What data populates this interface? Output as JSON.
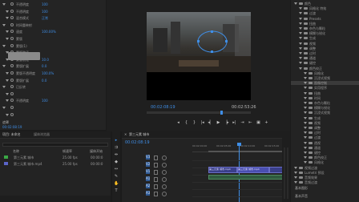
{
  "effect_controls": {
    "rows": [
      {
        "label": "不透明度",
        "value": "100"
      },
      {
        "label": "不透明度",
        "value": "100"
      },
      {
        "label": "混合模式",
        "value": "正常"
      },
      {
        "label": "时间重映射",
        "value": ""
      },
      {
        "label": "速度",
        "value": "100.00%"
      },
      {
        "label": "蒙版",
        "value": ""
      },
      {
        "label": "蒙版(1)",
        "value": ""
      },
      {
        "label": "蒙版路径",
        "value": ""
      },
      {
        "label": "蒙版羽化",
        "value": "10.0"
      },
      {
        "label": "蒙版扩展",
        "value": "0.0"
      },
      {
        "label": "蒙版不透明度",
        "value": "100.0%"
      },
      {
        "label": "蒙版扩展",
        "value": "0.0"
      },
      {
        "label": "已反转",
        "value": ""
      },
      {
        "label": "",
        "value": ""
      },
      {
        "label": "不透明度",
        "value": "100"
      },
      {
        "label": "",
        "value": ""
      },
      {
        "label": "",
        "value": ""
      }
    ],
    "bottom_label": "遮罩",
    "timecode": "00:02:08:19"
  },
  "program": {
    "timecode_left": "00:02:08:19",
    "timecode_right": "00:02:53:26",
    "controls": [
      "◂",
      "{",
      "}",
      "|◂",
      "◂▏",
      "▶",
      "▕▸",
      "▸|",
      "⇥",
      "⇤",
      "▣",
      "+"
    ]
  },
  "effects_browser": {
    "items": [
      {
        "label": "颜色"
      },
      {
        "label": "风格化 特效"
      },
      {
        "label": "过渡"
      },
      {
        "label": "Presets"
      },
      {
        "label": "扭曲"
      },
      {
        "label": "杂色与颗粒"
      },
      {
        "label": "模糊与锐化"
      },
      {
        "label": "生成"
      },
      {
        "label": "视频"
      },
      {
        "label": "调整"
      },
      {
        "label": "过时"
      },
      {
        "label": "通道"
      },
      {
        "label": "键控"
      },
      {
        "label": "颜色校正"
      },
      {
        "label": "风格化"
      },
      {
        "label": "沉浸式视频"
      },
      {
        "label": "图像控制"
      },
      {
        "label": "实用程序"
      },
      {
        "label": "扭曲"
      },
      {
        "label": "时间"
      },
      {
        "label": "杂色与颗粒"
      },
      {
        "label": "模糊与锐化"
      },
      {
        "label": "沉浸式视频"
      },
      {
        "label": "生成"
      },
      {
        "label": "视频"
      },
      {
        "label": "调整"
      },
      {
        "label": "过时"
      },
      {
        "label": "过渡"
      },
      {
        "label": "透视"
      },
      {
        "label": "通道"
      },
      {
        "label": "键控"
      },
      {
        "label": "颜色校正"
      },
      {
        "label": "风格化"
      },
      {
        "label": "视频过渡"
      },
      {
        "label": "Lumetri 预设"
      },
      {
        "label": "音频效果"
      },
      {
        "label": "音频过渡"
      }
    ],
    "footer": [
      "基本图形",
      "基本声音"
    ]
  },
  "project": {
    "tabs": [
      "项目: 未命名",
      "媒体浏览器"
    ],
    "search_placeholder": "",
    "columns": [
      "名称",
      "帧速率",
      "媒体开始"
    ],
    "rows": [
      {
        "name": "第三元素 城市",
        "rate": "25.00 fps",
        "start": "00:00:0"
      },
      {
        "name": "第三元素 城市.mp4",
        "rate": "25.00 fps",
        "start": "00:00:0"
      }
    ]
  },
  "timeline": {
    "title": "第三元素 城市",
    "timecode": "00:02:08:19",
    "ruler": [
      "00:02:00:00",
      "00:02:05:00",
      "00:02:10:00",
      "00:02:15:00"
    ],
    "tracks": [
      "V3",
      "V2",
      "V1",
      "A1",
      "A2",
      "A3"
    ],
    "clip_label": "第三元素 城市.mp4"
  },
  "colors": {
    "accent_blue": "#3f8ee6",
    "clip_purple": "#3a3f8a",
    "audio_green": "#2f5a3e"
  }
}
